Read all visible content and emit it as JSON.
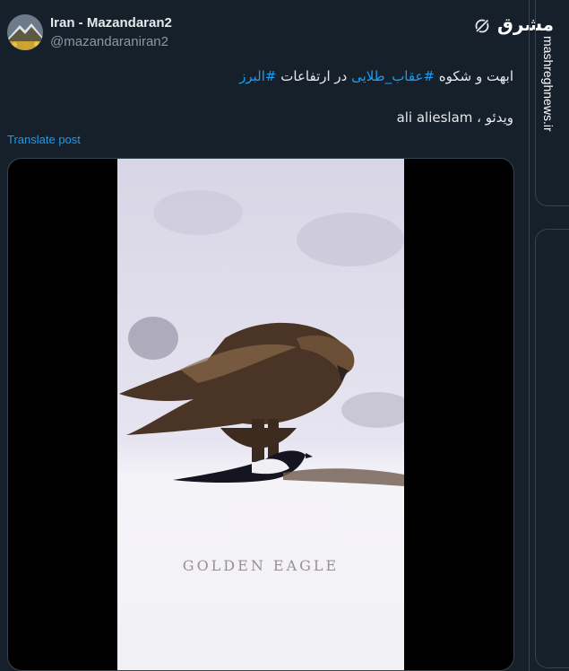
{
  "author": {
    "display_name": "Iran - Mazandaran2",
    "handle": "@mazandaraniran2"
  },
  "post": {
    "line1_parts": [
      "ابهت و شکوه ",
      "#عقاب_طلایی",
      " در ارتفاعات ",
      "#البرز"
    ],
    "line2": "ویدئو ، ali alieslam",
    "translate_label": "Translate post"
  },
  "media": {
    "caption": "GOLDEN EAGLE"
  },
  "watermark": {
    "logo_text": "مشرق",
    "url": "mashreghnews.ir"
  },
  "colors": {
    "background": "#15202b",
    "link": "#1d9bf0",
    "text": "#e7e9ea",
    "muted": "#8b98a5"
  },
  "icons": [
    "avatar",
    "grok-icon"
  ]
}
